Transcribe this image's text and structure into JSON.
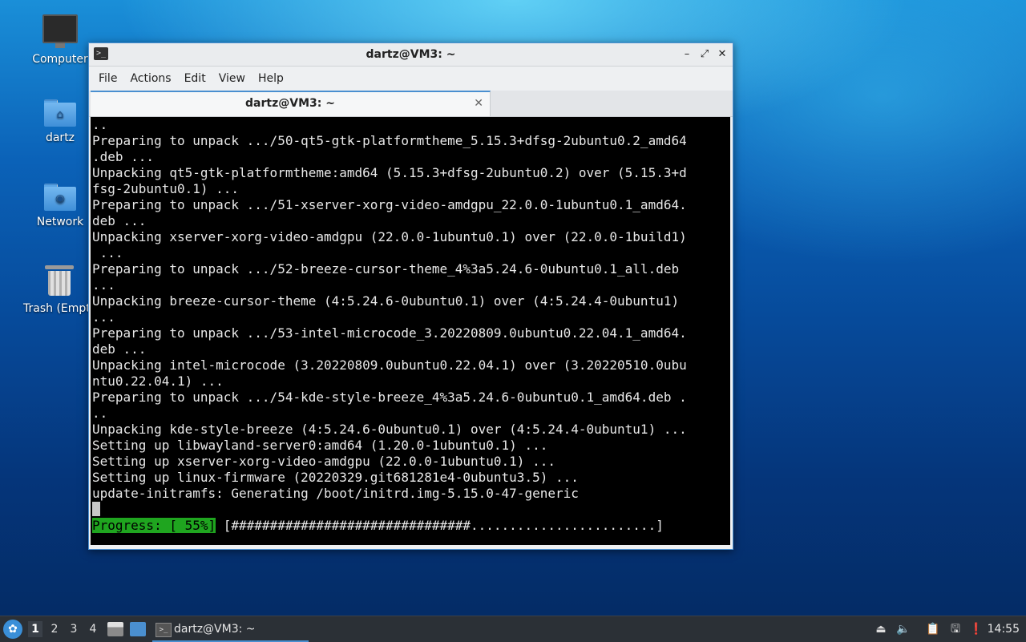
{
  "desktop": {
    "icons": [
      {
        "label": "Computer"
      },
      {
        "label": "dartz"
      },
      {
        "label": "Network"
      },
      {
        "label": "Trash (Empt"
      }
    ]
  },
  "window": {
    "title": "dartz@VM3: ~",
    "menu": [
      "File",
      "Actions",
      "Edit",
      "View",
      "Help"
    ],
    "tab_label": "dartz@VM3: ~",
    "terminal_lines": [
      "..",
      "Preparing to unpack .../50-qt5-gtk-platformtheme_5.15.3+dfsg-2ubuntu0.2_amd64",
      ".deb ...",
      "Unpacking qt5-gtk-platformtheme:amd64 (5.15.3+dfsg-2ubuntu0.2) over (5.15.3+d",
      "fsg-2ubuntu0.1) ...",
      "Preparing to unpack .../51-xserver-xorg-video-amdgpu_22.0.0-1ubuntu0.1_amd64.",
      "deb ...",
      "Unpacking xserver-xorg-video-amdgpu (22.0.0-1ubuntu0.1) over (22.0.0-1build1)",
      " ...",
      "Preparing to unpack .../52-breeze-cursor-theme_4%3a5.24.6-0ubuntu0.1_all.deb",
      "...",
      "Unpacking breeze-cursor-theme (4:5.24.6-0ubuntu0.1) over (4:5.24.4-0ubuntu1)",
      "...",
      "Preparing to unpack .../53-intel-microcode_3.20220809.0ubuntu0.22.04.1_amd64.",
      "deb ...",
      "Unpacking intel-microcode (3.20220809.0ubuntu0.22.04.1) over (3.20220510.0ubu",
      "ntu0.22.04.1) ...",
      "Preparing to unpack .../54-kde-style-breeze_4%3a5.24.6-0ubuntu0.1_amd64.deb .",
      "..",
      "Unpacking kde-style-breeze (4:5.24.6-0ubuntu0.1) over (4:5.24.4-0ubuntu1) ...",
      "Setting up libwayland-server0:amd64 (1.20.0-1ubuntu0.1) ...",
      "Setting up xserver-xorg-video-amdgpu (22.0.0-1ubuntu0.1) ...",
      "Setting up linux-firmware (20220329.git681281e4-0ubuntu3.5) ...",
      "update-initramfs: Generating /boot/initrd.img-5.15.0-47-generic"
    ],
    "progress_label": "Progress: [ 55%]",
    "progress_bar": "[###############################........................]",
    "progress_value": 0.55
  },
  "taskbar": {
    "workspaces": [
      "1",
      "2",
      "3",
      "4"
    ],
    "active_workspace": "1",
    "task_label": "dartz@VM3: ~",
    "clock": "14:55"
  },
  "colors": {
    "accent": "#4a8fd0",
    "progress_green": "#1fa51f",
    "terminal_bg": "#000000"
  }
}
